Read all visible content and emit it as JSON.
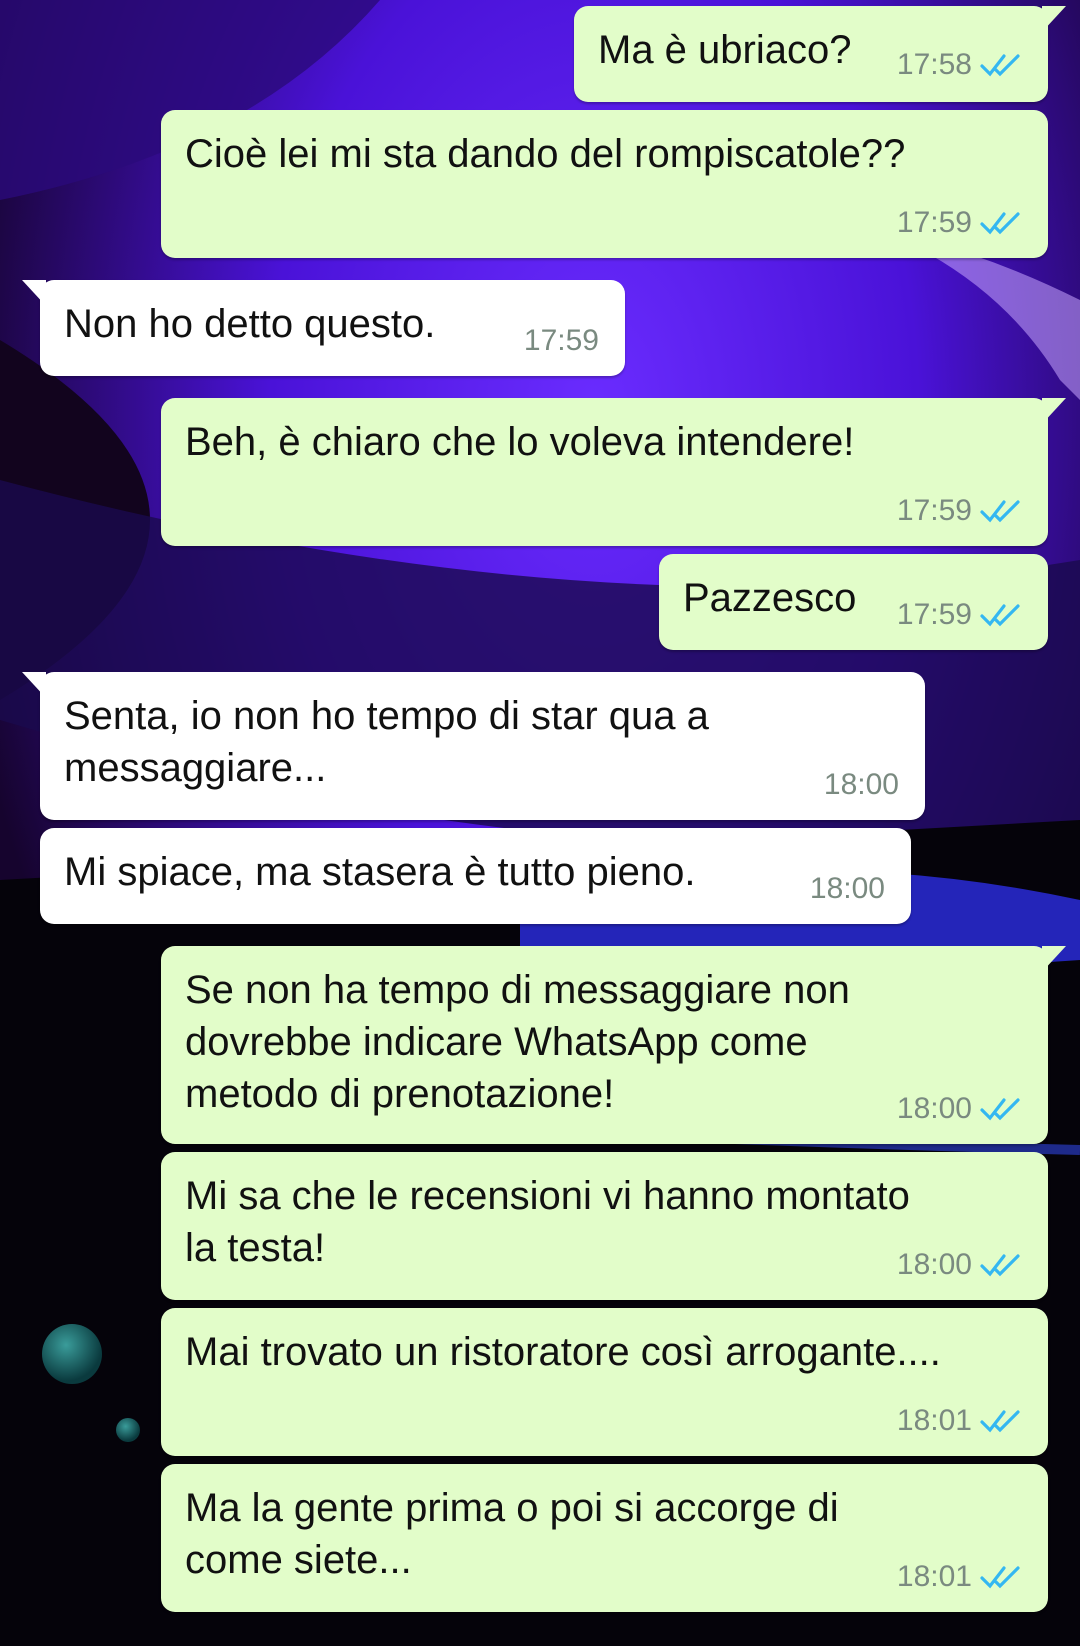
{
  "colors": {
    "outgoing_bubble": "#e2fdc9",
    "incoming_bubble": "#ffffff",
    "read_ticks": "#34b7f1",
    "timestamp": "#7a8a80"
  },
  "icons": {
    "read_receipt": "double-check-icon"
  },
  "messages": [
    {
      "direction": "out",
      "text": "Ma è ubriaco?",
      "time": "17:58"
    },
    {
      "direction": "out",
      "text": "Cioè lei mi sta dando del rompiscatole??",
      "time": "17:59"
    },
    {
      "direction": "in",
      "text": "Non ho detto questo.",
      "time": "17:59"
    },
    {
      "direction": "out",
      "text": "Beh, è chiaro che lo voleva intendere!",
      "time": "17:59"
    },
    {
      "direction": "out",
      "text": "Pazzesco",
      "time": "17:59"
    },
    {
      "direction": "in",
      "text": "Senta, io non ho tempo di star qua a\nmessaggiare...",
      "time": "18:00"
    },
    {
      "direction": "in",
      "text": "Mi spiace, ma stasera è tutto pieno.",
      "time": "18:00"
    },
    {
      "direction": "out",
      "text": "Se non ha tempo di messaggiare non\ndovrebbe indicare WhatsApp come\nmetodo di prenotazione!",
      "time": "18:00"
    },
    {
      "direction": "out",
      "text": "Mi sa che le recensioni vi hanno montato\nla testa!",
      "time": "18:00"
    },
    {
      "direction": "out",
      "text": "Mai trovato un ristoratore così arrogante....",
      "time": "18:01"
    },
    {
      "direction": "out",
      "text": "Ma la gente prima o poi si accorge di\ncome siete...",
      "time": "18:01"
    }
  ]
}
